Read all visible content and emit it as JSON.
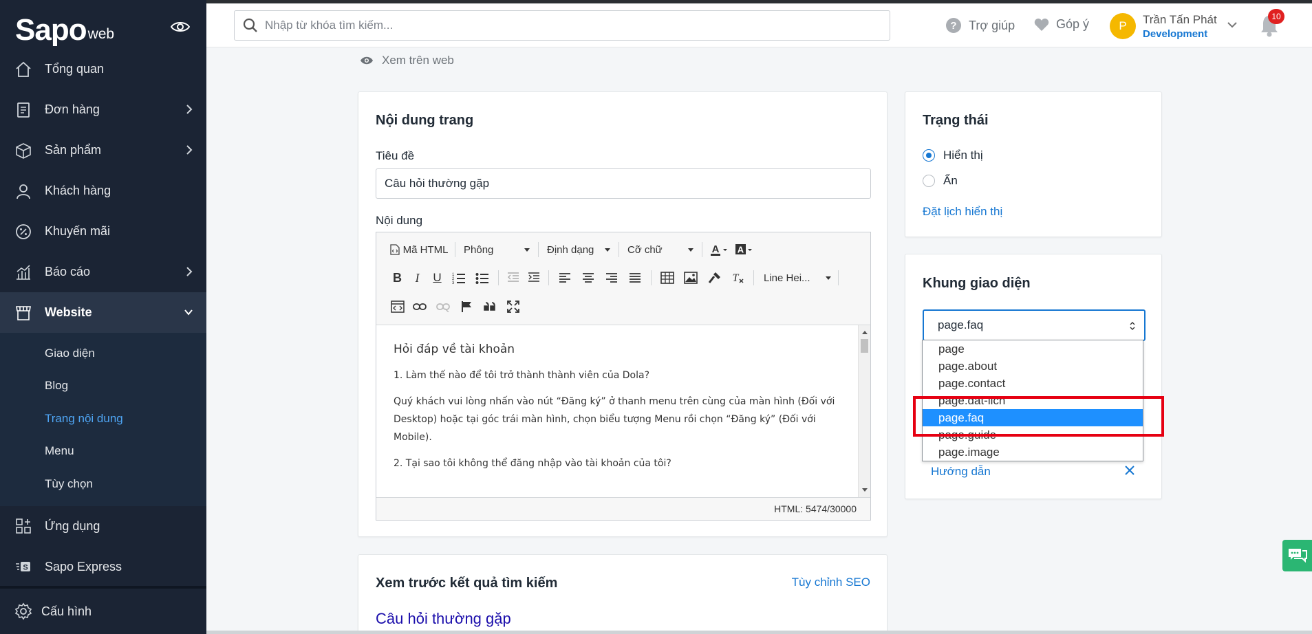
{
  "brand": {
    "logo_main": "Sapo",
    "logo_suffix": "web"
  },
  "sidebar": {
    "items": [
      {
        "label": "Tổng quan",
        "icon": "home-icon"
      },
      {
        "label": "Đơn hàng",
        "icon": "order-icon"
      },
      {
        "label": "Sản phẩm",
        "icon": "box-icon"
      },
      {
        "label": "Khách hàng",
        "icon": "user-icon"
      },
      {
        "label": "Khuyến mãi",
        "icon": "percent-icon"
      },
      {
        "label": "Báo cáo",
        "icon": "chart-icon"
      },
      {
        "label": "Website",
        "icon": "store-icon"
      },
      {
        "label": "Ứng dụng",
        "icon": "apps-icon"
      },
      {
        "label": "Sapo Express",
        "icon": "express-icon"
      }
    ],
    "submenu": [
      "Giao diện",
      "Blog",
      "Trang nội dung",
      "Menu",
      "Tùy chọn"
    ],
    "settings_label": "Cấu hình"
  },
  "header": {
    "search_placeholder": "Nhập từ khóa tìm kiếm...",
    "help_label": "Trợ giúp",
    "feedback_label": "Góp ý",
    "user_initial": "P",
    "user_name": "Trần Tấn Phát",
    "user_role": "Development",
    "notification_count": "10"
  },
  "view_on_web": "Xem trên web",
  "content": {
    "title": "Nội dung trang",
    "title_label": "Tiêu đề",
    "title_value": "Câu hỏi thường gặp",
    "content_label": "Nội dung",
    "toolbar": {
      "html_btn": "Mã HTML",
      "font": "Phông",
      "format": "Định dạng",
      "size": "Cỡ chữ",
      "line_height": "Line Hei..."
    },
    "body": {
      "heading": "Hỏi đáp về tài khoản",
      "q1": "1. Làm thế nào để tôi trở thành thành viên của Dola?",
      "a1": "Quý khách vui lòng nhấn vào nút “Đăng ký” ở thanh menu trên cùng của màn hình (Đối với Desktop) hoặc tại góc trái màn hình, chọn biểu tượng Menu rồi chọn “Đăng ký” (Đối với Mobile).",
      "q2": "2. Tại sao tôi không thể đăng nhập vào tài khoản của tôi?"
    },
    "html_counter": "HTML: 5474/30000"
  },
  "status": {
    "title": "Trạng thái",
    "options": [
      "Hiển thị",
      "Ẩn"
    ],
    "selected": "Hiển thị",
    "schedule_link": "Đặt lịch hiển thị"
  },
  "layout": {
    "title": "Khung giao diện",
    "selected": "page.faq",
    "options": [
      "page",
      "page.about",
      "page.contact",
      "page.dat-lich",
      "page.faq",
      "page.guide",
      "page.image"
    ],
    "guide_link": "Hướng dẫn"
  },
  "seo": {
    "title": "Xem trước kết quả tìm kiếm",
    "customize_link": "Tùy chỉnh SEO",
    "page_title": "Câu hỏi thường gặp"
  },
  "colors": {
    "sidebar_bg": "#1b2434",
    "accent": "#1677d2",
    "highlight": "#1e90ff",
    "annotation": "#e60012"
  }
}
